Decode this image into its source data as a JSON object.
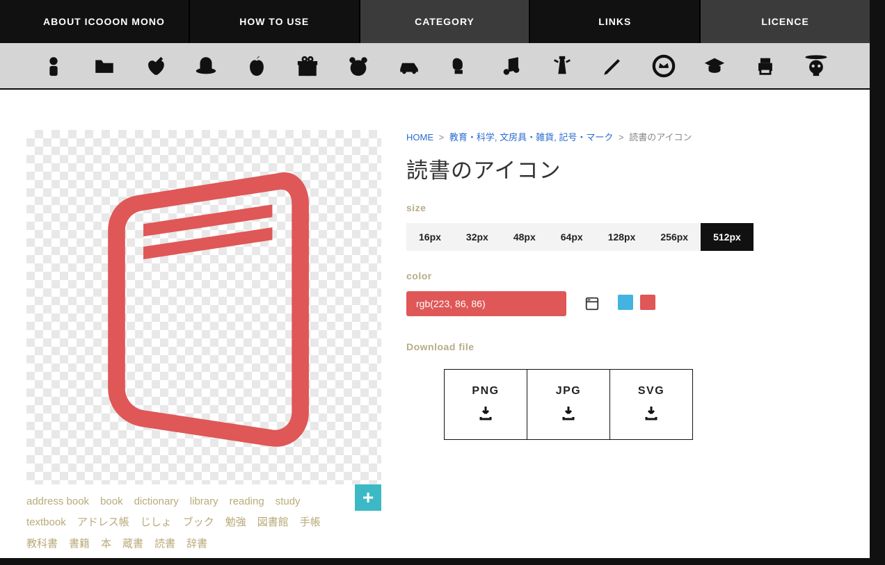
{
  "nav": {
    "items": [
      {
        "label": "ABOUT ICOOON MONO",
        "dim": false
      },
      {
        "label": "HOW TO USE",
        "dim": false
      },
      {
        "label": "CATEGORY",
        "dim": true
      },
      {
        "label": "LINKS",
        "dim": false
      },
      {
        "label": "LICENCE",
        "dim": true
      }
    ]
  },
  "categories": [
    "person-icon",
    "folder-icon",
    "syringe-heart-icon",
    "hat-icon",
    "apple-icon",
    "gift-icon",
    "bear-icon",
    "car-icon",
    "boxing-glove-icon",
    "music-note-icon",
    "lighthouse-icon",
    "pencil-icon",
    "crown-badge-icon",
    "graduation-cap-icon",
    "printer-icon",
    "skull-pirate-icon"
  ],
  "breadcrumb": {
    "home": "HOME",
    "links": [
      "教育・科学",
      "文房具・雑貨",
      "記号・マーク"
    ],
    "current": "読書のアイコン"
  },
  "title": "読書のアイコン",
  "labels": {
    "size": "size",
    "color": "color",
    "download": "Download file"
  },
  "sizes": [
    "16px",
    "32px",
    "48px",
    "64px",
    "128px",
    "256px",
    "512px"
  ],
  "active_size": "512px",
  "color_value": "rgb(223, 86, 86)",
  "icon_color": "#df5757",
  "swatches": [
    "#44b3e0",
    "#df5757"
  ],
  "downloads": [
    "PNG",
    "JPG",
    "SVG"
  ],
  "tags": [
    "address book",
    "book",
    "dictionary",
    "library",
    "reading",
    "study",
    "textbook",
    "アドレス帳",
    "じしょ",
    "ブック",
    "勉強",
    "図書館",
    "手帳",
    "教科書",
    "書籍",
    "本",
    "蔵書",
    "読書",
    "辞書"
  ],
  "add_label": "+"
}
